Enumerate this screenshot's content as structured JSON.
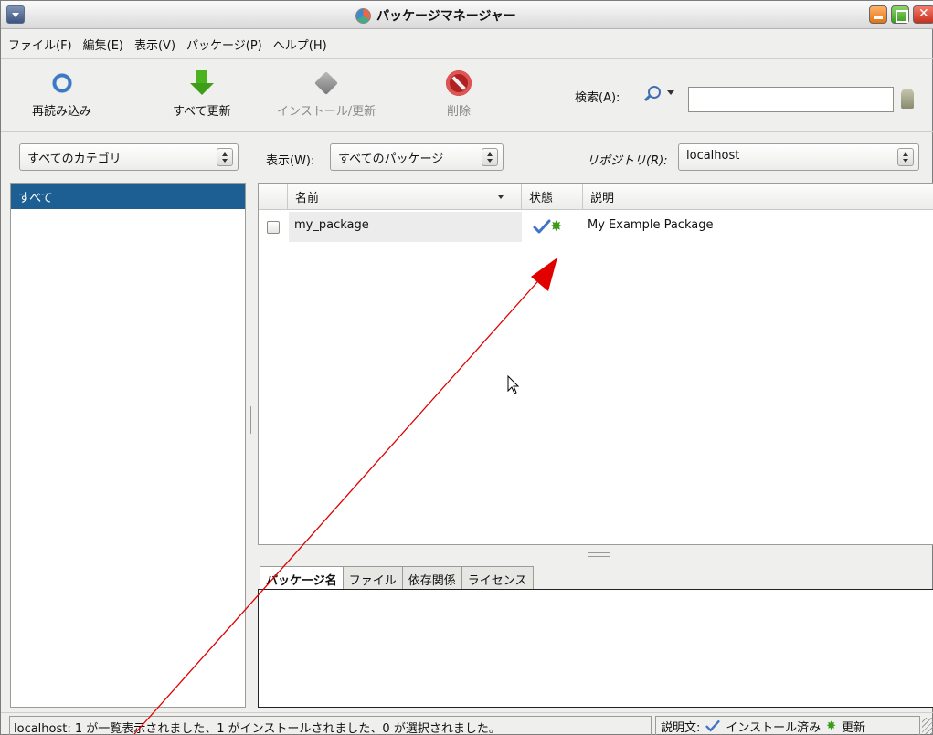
{
  "window": {
    "title": "パッケージマネージャー"
  },
  "menubar": {
    "items": [
      "ファイル(F)",
      "編集(E)",
      "表示(V)",
      "パッケージ(P)",
      "ヘルプ(H)"
    ]
  },
  "toolbar": {
    "reload_label": "再読み込み",
    "update_all_label": "すべて更新",
    "install_update_label": "インストール/更新",
    "delete_label": "削除",
    "search_label": "検索(A):",
    "search_value": ""
  },
  "filters": {
    "category": "すべてのカテゴリ",
    "view_label": "表示(W):",
    "view_value": "すべてのパッケージ",
    "repo_label": "リポジトリ(R):",
    "repo_value": "localhost"
  },
  "categories": [
    {
      "label": "すべて",
      "selected": true
    }
  ],
  "package_table": {
    "columns": [
      "名前",
      "状態",
      "説明"
    ],
    "rows": [
      {
        "name": "my_package",
        "status_icons": [
          "installed-check-icon",
          "update-star-icon"
        ],
        "description": "My Example Package",
        "checked": false
      }
    ]
  },
  "detail_tabs": [
    "パッケージ名",
    "ファイル",
    "依存関係",
    "ライセンス"
  ],
  "statusbar": {
    "message": "localhost: 1 が一覧表示されました、1 がインストールされました、0 が選択されました。",
    "legend_prefix": "説明文:",
    "legend_installed": "インストール済み",
    "legend_update": "更新"
  },
  "colors": {
    "selection": "#1d5f93",
    "annotation_arrow": "#e00000"
  }
}
